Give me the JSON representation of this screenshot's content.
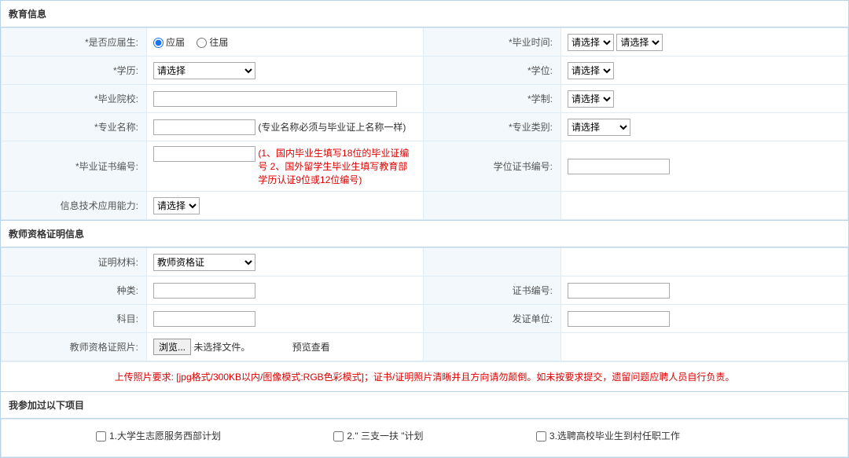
{
  "sections": {
    "education": "教育信息",
    "teacher_cert": "教师资格证明信息",
    "participated": "我参加过以下项目"
  },
  "labels": {
    "fresh_grad": "是否应届生:",
    "grad_time": "毕业时间:",
    "education_level": "学历:",
    "degree": "学位:",
    "school": "毕业院校:",
    "school_system": "学制:",
    "major": "专业名称:",
    "major_hint": "(专业名称必须与毕业证上名称一样)",
    "major_type": "专业类别:",
    "diploma_no": "毕业证书编号:",
    "diploma_hint": "(1、国内毕业生填写18位的毕业证编号 2、国外留学生毕业生填写教育部学历认证9位或12位编号)",
    "degree_cert_no": "学位证书编号:",
    "it_skill": "信息技术应用能力:",
    "cert_material": "证明材料:",
    "cert_type": "种类:",
    "cert_no": "证书编号:",
    "subject": "科目:",
    "issuer": "发证单位:",
    "cert_photo": "教师资格证照片:",
    "browse": "浏览...",
    "no_file": "未选择文件。",
    "preview": "预览查看"
  },
  "options": {
    "radio1": "应届",
    "radio2": "往届",
    "please_select": "请选择",
    "teacher_cert": "教师资格证"
  },
  "upload_hint": "上传照片要求: [jpg格式/300KB以内/图像模式:RGB色彩模式]；证书/证明照片清晰并且方向请勿颠倒。如未按要求提交，遗留问题应聘人员自行负责。",
  "checkboxes": {
    "cb1": "1.大学生志愿服务西部计划",
    "cb2": "2.\" 三支一扶 \"计划",
    "cb3": "3.选聘高校毕业生到村任职工作"
  }
}
